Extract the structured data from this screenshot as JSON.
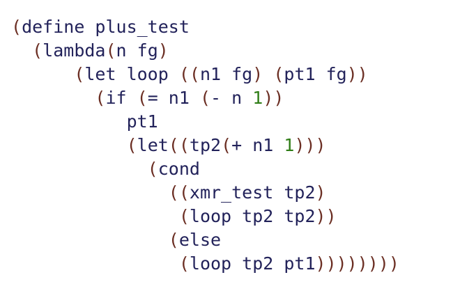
{
  "colors": {
    "background": "#ffffff",
    "symbol": "#22225a",
    "paren": "#6b2e23",
    "number": "#2f7d17"
  },
  "code_lines": [
    {
      "indent": "",
      "tokens": [
        {
          "t": "(",
          "k": "paren"
        },
        {
          "t": "define plus_test",
          "k": "sym"
        }
      ]
    },
    {
      "indent": "  ",
      "tokens": [
        {
          "t": "(",
          "k": "paren"
        },
        {
          "t": "lambda",
          "k": "sym"
        },
        {
          "t": "(",
          "k": "paren"
        },
        {
          "t": "n fg",
          "k": "sym"
        },
        {
          "t": ")",
          "k": "paren"
        }
      ]
    },
    {
      "indent": "      ",
      "tokens": [
        {
          "t": "(",
          "k": "paren"
        },
        {
          "t": "let loop ",
          "k": "sym"
        },
        {
          "t": "((",
          "k": "paren"
        },
        {
          "t": "n1 fg",
          "k": "sym"
        },
        {
          "t": ")",
          "k": "paren"
        },
        {
          "t": " ",
          "k": "sym"
        },
        {
          "t": "(",
          "k": "paren"
        },
        {
          "t": "pt1 fg",
          "k": "sym"
        },
        {
          "t": "))",
          "k": "paren"
        }
      ]
    },
    {
      "indent": "        ",
      "tokens": [
        {
          "t": "(",
          "k": "paren"
        },
        {
          "t": "if ",
          "k": "sym"
        },
        {
          "t": "(",
          "k": "paren"
        },
        {
          "t": "= n1 ",
          "k": "sym"
        },
        {
          "t": "(",
          "k": "paren"
        },
        {
          "t": "- n ",
          "k": "sym"
        },
        {
          "t": "1",
          "k": "num"
        },
        {
          "t": "))",
          "k": "paren"
        }
      ]
    },
    {
      "indent": "           ",
      "tokens": [
        {
          "t": "pt1",
          "k": "sym"
        }
      ]
    },
    {
      "indent": "           ",
      "tokens": [
        {
          "t": "(",
          "k": "paren"
        },
        {
          "t": "let",
          "k": "sym"
        },
        {
          "t": "((",
          "k": "paren"
        },
        {
          "t": "tp2",
          "k": "sym"
        },
        {
          "t": "(",
          "k": "paren"
        },
        {
          "t": "+ n1 ",
          "k": "sym"
        },
        {
          "t": "1",
          "k": "num"
        },
        {
          "t": ")))",
          "k": "paren"
        }
      ]
    },
    {
      "indent": "             ",
      "tokens": [
        {
          "t": "(",
          "k": "paren"
        },
        {
          "t": "cond",
          "k": "sym"
        }
      ]
    },
    {
      "indent": "               ",
      "tokens": [
        {
          "t": "((",
          "k": "paren"
        },
        {
          "t": "xmr_test tp2",
          "k": "sym"
        },
        {
          "t": ")",
          "k": "paren"
        }
      ]
    },
    {
      "indent": "                ",
      "tokens": [
        {
          "t": "(",
          "k": "paren"
        },
        {
          "t": "loop tp2 tp2",
          "k": "sym"
        },
        {
          "t": "))",
          "k": "paren"
        }
      ]
    },
    {
      "indent": "               ",
      "tokens": [
        {
          "t": "(",
          "k": "paren"
        },
        {
          "t": "else",
          "k": "sym"
        }
      ]
    },
    {
      "indent": "                ",
      "tokens": [
        {
          "t": "(",
          "k": "paren"
        },
        {
          "t": "loop tp2 pt1",
          "k": "sym"
        },
        {
          "t": "))))))))",
          "k": "paren"
        }
      ]
    }
  ]
}
